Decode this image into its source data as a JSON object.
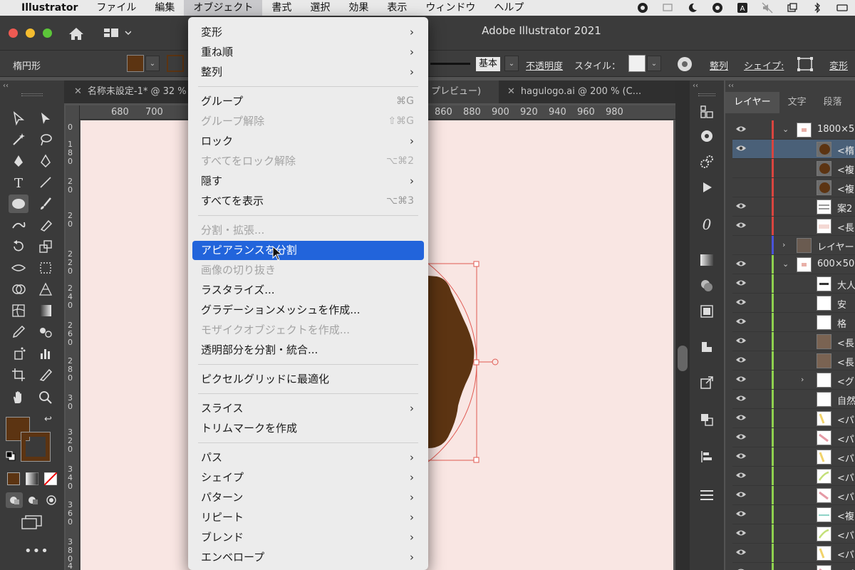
{
  "menubar": {
    "app": "Illustrator",
    "items": [
      "ファイル",
      "編集",
      "オブジェクト",
      "書式",
      "選択",
      "効果",
      "表示",
      "ウィンドウ",
      "ヘルプ"
    ]
  },
  "window": {
    "title": "Adobe Illustrator 2021"
  },
  "control_bar": {
    "object_type": "楕円形",
    "fill_color": "#5c3412",
    "stroke_style": "基本",
    "opacity_label": "不透明度",
    "style_label": "スタイル：",
    "align_label": "整列",
    "shape_label": "シェイプ:",
    "transform_label": "変形"
  },
  "tabs": [
    {
      "label": "名称未設定-1* @ 32 %"
    },
    {
      "label": "プレビュー)"
    },
    {
      "label": "hagulogo.ai @ 200 % (C..."
    }
  ],
  "ruler_labels": [
    "680",
    "700",
    "860",
    "880",
    "900",
    "920",
    "940",
    "960",
    "980"
  ],
  "ruler_v_labels": [
    "0",
    "1",
    "8",
    "0",
    "2",
    "0",
    "2",
    "0",
    "2",
    "2",
    "0",
    "2",
    "4",
    "0",
    "2",
    "6",
    "0",
    "2",
    "8",
    "0",
    "3",
    "0",
    "3",
    "2",
    "0",
    "3",
    "4",
    "0",
    "3",
    "6",
    "0",
    "3",
    "8",
    "0",
    "4",
    "0",
    "4"
  ],
  "object_menu": {
    "items": [
      {
        "label": "変形",
        "submenu": true,
        "enabled": true,
        "highlighted": false,
        "shortcut": ""
      },
      {
        "label": "重ね順",
        "submenu": true,
        "enabled": true,
        "highlighted": false,
        "shortcut": ""
      },
      {
        "label": "整列",
        "submenu": true,
        "enabled": true,
        "highlighted": false,
        "shortcut": ""
      },
      {
        "separator": true
      },
      {
        "label": "グループ",
        "submenu": false,
        "enabled": true,
        "highlighted": false,
        "shortcut": "⌘G"
      },
      {
        "label": "グループ解除",
        "submenu": false,
        "enabled": false,
        "highlighted": false,
        "shortcut": "⇧⌘G"
      },
      {
        "label": "ロック",
        "submenu": true,
        "enabled": true,
        "highlighted": false,
        "shortcut": ""
      },
      {
        "label": "すべてをロック解除",
        "submenu": false,
        "enabled": false,
        "highlighted": false,
        "shortcut": "⌥⌘2"
      },
      {
        "label": "隠す",
        "submenu": true,
        "enabled": true,
        "highlighted": false,
        "shortcut": ""
      },
      {
        "label": "すべてを表示",
        "submenu": false,
        "enabled": true,
        "highlighted": false,
        "shortcut": "⌥⌘3"
      },
      {
        "separator": true
      },
      {
        "label": "分割・拡張...",
        "submenu": false,
        "enabled": false,
        "highlighted": false,
        "shortcut": ""
      },
      {
        "label": "アピアランスを分割",
        "submenu": false,
        "enabled": true,
        "highlighted": true,
        "shortcut": ""
      },
      {
        "label": "画像の切り抜き",
        "submenu": false,
        "enabled": false,
        "highlighted": false,
        "shortcut": ""
      },
      {
        "label": "ラスタライズ...",
        "submenu": false,
        "enabled": true,
        "highlighted": false,
        "shortcut": ""
      },
      {
        "label": "グラデーションメッシュを作成...",
        "submenu": false,
        "enabled": true,
        "highlighted": false,
        "shortcut": ""
      },
      {
        "label": "モザイクオブジェクトを作成...",
        "submenu": false,
        "enabled": false,
        "highlighted": false,
        "shortcut": ""
      },
      {
        "label": "透明部分を分割・統合...",
        "submenu": false,
        "enabled": true,
        "highlighted": false,
        "shortcut": ""
      },
      {
        "separator": true
      },
      {
        "label": "ピクセルグリッドに最適化",
        "submenu": false,
        "enabled": true,
        "highlighted": false,
        "shortcut": ""
      },
      {
        "separator": true
      },
      {
        "label": "スライス",
        "submenu": true,
        "enabled": true,
        "highlighted": false,
        "shortcut": ""
      },
      {
        "label": "トリムマークを作成",
        "submenu": false,
        "enabled": true,
        "highlighted": false,
        "shortcut": ""
      },
      {
        "separator": true
      },
      {
        "label": "パス",
        "submenu": true,
        "enabled": true,
        "highlighted": false,
        "shortcut": ""
      },
      {
        "label": "シェイプ",
        "submenu": true,
        "enabled": true,
        "highlighted": false,
        "shortcut": ""
      },
      {
        "label": "パターン",
        "submenu": true,
        "enabled": true,
        "highlighted": false,
        "shortcut": ""
      },
      {
        "label": "リピート",
        "submenu": true,
        "enabled": true,
        "highlighted": false,
        "shortcut": ""
      },
      {
        "label": "ブレンド",
        "submenu": true,
        "enabled": true,
        "highlighted": false,
        "shortcut": ""
      },
      {
        "label": "エンベロープ",
        "submenu": true,
        "enabled": true,
        "highlighted": false,
        "shortcut": ""
      }
    ]
  },
  "layers_panel": {
    "tabs": [
      "レイヤー",
      "文字",
      "段落"
    ],
    "rows": [
      {
        "name": "1800×5",
        "bar": "#d9453f",
        "eye": true,
        "indent": 0,
        "expanded": true,
        "thumb": "doc",
        "selected": false
      },
      {
        "name": "<楕",
        "bar": "#d9453f",
        "eye": true,
        "indent": 2,
        "expanded": null,
        "thumb": "circle",
        "selected": true
      },
      {
        "name": "<複",
        "bar": "#d9453f",
        "eye": false,
        "indent": 2,
        "expanded": null,
        "thumb": "circle",
        "selected": false
      },
      {
        "name": "<複",
        "bar": "#d9453f",
        "eye": false,
        "indent": 2,
        "expanded": null,
        "thumb": "circle",
        "selected": false
      },
      {
        "name": "案2",
        "bar": "#d9453f",
        "eye": true,
        "indent": 2,
        "expanded": null,
        "thumb": "lines",
        "selected": false
      },
      {
        "name": "<長",
        "bar": "#d9453f",
        "eye": true,
        "indent": 2,
        "expanded": null,
        "thumb": "pink",
        "selected": false
      },
      {
        "name": "レイヤー",
        "bar": "#4a53d8",
        "eye": false,
        "indent": 0,
        "expanded": false,
        "thumb": "dark",
        "selected": false
      },
      {
        "name": "600×50",
        "bar": "#8fd14f",
        "eye": true,
        "indent": 0,
        "expanded": true,
        "thumb": "doc",
        "selected": false
      },
      {
        "name": "大人",
        "bar": "#8fd14f",
        "eye": true,
        "indent": 2,
        "expanded": null,
        "thumb": "text",
        "selected": false
      },
      {
        "name": "安",
        "bar": "#8fd14f",
        "eye": true,
        "indent": 2,
        "expanded": null,
        "thumb": "blank",
        "selected": false
      },
      {
        "name": "格",
        "bar": "#8fd14f",
        "eye": true,
        "indent": 2,
        "expanded": null,
        "thumb": "blank",
        "selected": false
      },
      {
        "name": "<長",
        "bar": "#8fd14f",
        "eye": true,
        "indent": 2,
        "expanded": null,
        "thumb": "brown",
        "selected": false
      },
      {
        "name": "<長",
        "bar": "#8fd14f",
        "eye": true,
        "indent": 2,
        "expanded": null,
        "thumb": "brown",
        "selected": false
      },
      {
        "name": "<グ",
        "bar": "#8fd14f",
        "eye": true,
        "indent": 1,
        "expanded": false,
        "thumb": "blank",
        "selected": false
      },
      {
        "name": "自然",
        "bar": "#8fd14f",
        "eye": true,
        "indent": 2,
        "expanded": null,
        "thumb": "blank",
        "selected": false
      },
      {
        "name": "<パ",
        "bar": "#8fd14f",
        "eye": true,
        "indent": 2,
        "expanded": null,
        "thumb": "yellow",
        "selected": false
      },
      {
        "name": "<パ",
        "bar": "#8fd14f",
        "eye": true,
        "indent": 2,
        "expanded": null,
        "thumb": "pinkstroke",
        "selected": false
      },
      {
        "name": "<パ",
        "bar": "#8fd14f",
        "eye": true,
        "indent": 2,
        "expanded": null,
        "thumb": "yellow",
        "selected": false
      },
      {
        "name": "<パ",
        "bar": "#8fd14f",
        "eye": true,
        "indent": 2,
        "expanded": null,
        "thumb": "green",
        "selected": false
      },
      {
        "name": "<パ",
        "bar": "#8fd14f",
        "eye": true,
        "indent": 2,
        "expanded": null,
        "thumb": "pinkstroke",
        "selected": false
      },
      {
        "name": "<複",
        "bar": "#8fd14f",
        "eye": true,
        "indent": 2,
        "expanded": null,
        "thumb": "teal",
        "selected": false
      },
      {
        "name": "<パ",
        "bar": "#8fd14f",
        "eye": true,
        "indent": 2,
        "expanded": null,
        "thumb": "green",
        "selected": false
      },
      {
        "name": "<パ",
        "bar": "#8fd14f",
        "eye": true,
        "indent": 2,
        "expanded": null,
        "thumb": "yellow",
        "selected": false
      },
      {
        "name": "<パ",
        "bar": "#8fd14f",
        "eye": true,
        "indent": 2,
        "expanded": null,
        "thumb": "pinkstroke",
        "selected": false
      }
    ]
  },
  "colors": {
    "canvas": "#f9e6e3",
    "brown": "#5c3412",
    "highlight": "#2264db",
    "selection": "#e05a52"
  }
}
